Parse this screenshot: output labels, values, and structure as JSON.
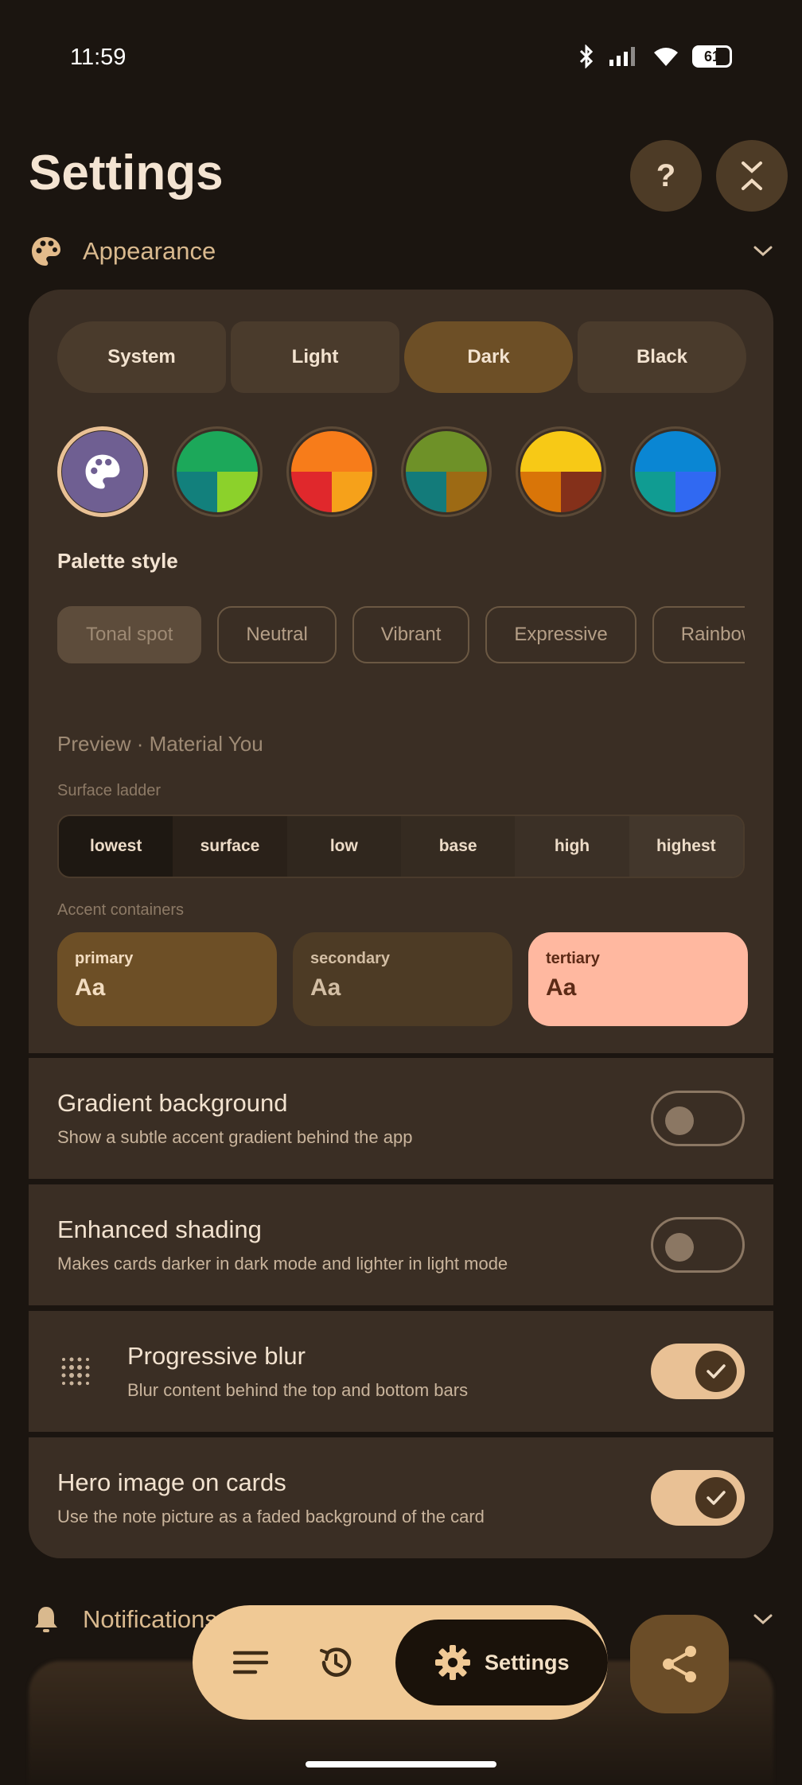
{
  "status_bar": {
    "time": "11:59",
    "battery": "61"
  },
  "header": {
    "title": "Settings",
    "help_label": "?"
  },
  "appearance": {
    "label": "Appearance",
    "theme_modes": [
      "System",
      "Light",
      "Dark",
      "Black"
    ],
    "selected_mode": "Dark",
    "palette_style_label": "Palette style",
    "palette_styles": [
      "Tonal spot",
      "Neutral",
      "Vibrant",
      "Expressive",
      "Rainbow"
    ],
    "preview_label": "Preview · Material You",
    "surface_ladder_label": "Surface ladder",
    "surface_ladder": [
      "lowest",
      "surface",
      "low",
      "base",
      "high",
      "highest"
    ],
    "accent_containers_label": "Accent containers",
    "accents": [
      {
        "name": "primary",
        "sample": "Aa"
      },
      {
        "name": "secondary",
        "sample": "Aa"
      },
      {
        "name": "tertiary",
        "sample": "Aa"
      }
    ]
  },
  "rows": [
    {
      "title": "Gradient background",
      "subtitle": "Show a subtle accent gradient behind the app",
      "enabled": false
    },
    {
      "title": "Enhanced shading",
      "subtitle": "Makes cards darker in dark mode and lighter in light mode",
      "enabled": false
    },
    {
      "title": "Progressive blur",
      "subtitle": "Blur content behind the top and bottom bars",
      "enabled": true,
      "icon": "blur-dots-icon"
    },
    {
      "title": "Hero image on cards",
      "subtitle": "Use the note picture as a faded background of the card",
      "enabled": true
    }
  ],
  "notifications": {
    "label": "Notifications"
  },
  "bottom_nav": {
    "settings_label": "Settings"
  },
  "colors": {
    "background": "#1b1510",
    "card": "#3a2e24",
    "accent": "#e9c195",
    "primary_container": "#6d4f26",
    "tertiary_container": "#ffb8a0"
  }
}
